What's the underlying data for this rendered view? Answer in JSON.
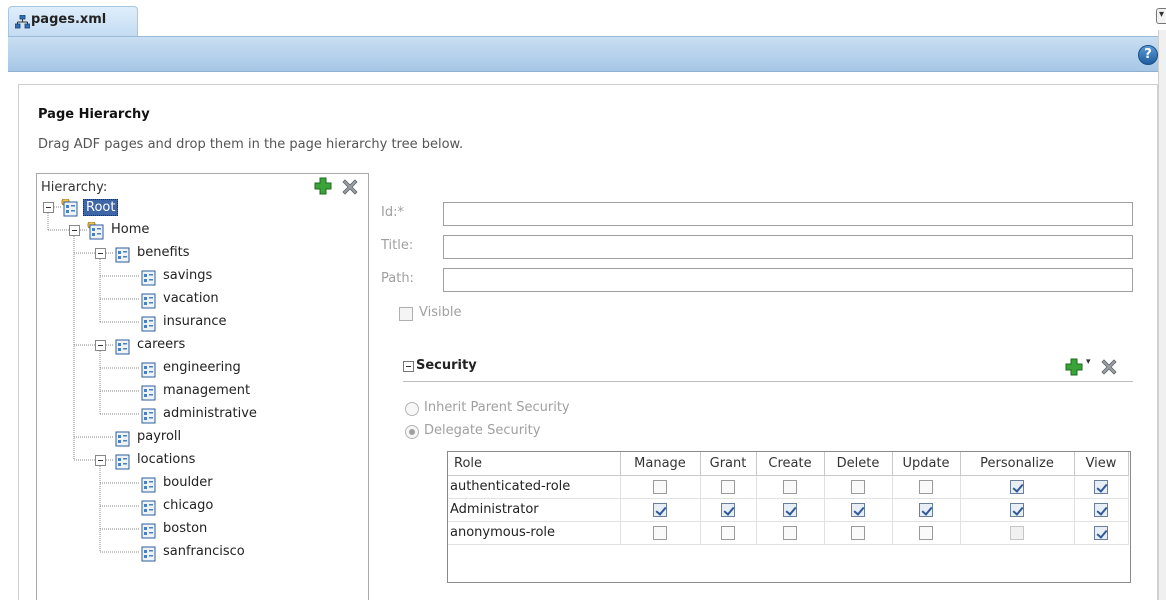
{
  "tab": {
    "label": "pages.xml",
    "icon": "sitemap-icon"
  },
  "help": {
    "label": "?"
  },
  "heading": {
    "title": "Page Hierarchy",
    "description": "Drag ADF pages and drop them in the page hierarchy tree below."
  },
  "hierarchy": {
    "label": "Hierarchy:",
    "nodes": [
      {
        "label": "Root",
        "depth": 0,
        "expandable": true,
        "selected": true,
        "icon": "secure-page-icon"
      },
      {
        "label": "Home",
        "depth": 1,
        "expandable": true,
        "selected": false,
        "icon": "secure-page-icon"
      },
      {
        "label": "benefits",
        "depth": 2,
        "expandable": true,
        "selected": false,
        "icon": "page-icon"
      },
      {
        "label": "savings",
        "depth": 3,
        "expandable": false,
        "selected": false,
        "icon": "page-icon"
      },
      {
        "label": "vacation",
        "depth": 3,
        "expandable": false,
        "selected": false,
        "icon": "page-icon"
      },
      {
        "label": "insurance",
        "depth": 3,
        "expandable": false,
        "selected": false,
        "icon": "page-icon"
      },
      {
        "label": "careers",
        "depth": 2,
        "expandable": true,
        "selected": false,
        "icon": "page-icon"
      },
      {
        "label": "engineering",
        "depth": 3,
        "expandable": false,
        "selected": false,
        "icon": "page-icon"
      },
      {
        "label": "management",
        "depth": 3,
        "expandable": false,
        "selected": false,
        "icon": "page-icon"
      },
      {
        "label": "administrative",
        "depth": 3,
        "expandable": false,
        "selected": false,
        "icon": "page-icon"
      },
      {
        "label": "payroll",
        "depth": 2,
        "expandable": false,
        "selected": false,
        "icon": "page-icon"
      },
      {
        "label": "locations",
        "depth": 2,
        "expandable": true,
        "selected": false,
        "icon": "page-icon"
      },
      {
        "label": "boulder",
        "depth": 3,
        "expandable": false,
        "selected": false,
        "icon": "page-icon"
      },
      {
        "label": "chicago",
        "depth": 3,
        "expandable": false,
        "selected": false,
        "icon": "page-icon"
      },
      {
        "label": "boston",
        "depth": 3,
        "expandable": false,
        "selected": false,
        "icon": "page-icon"
      },
      {
        "label": "sanfrancisco",
        "depth": 3,
        "expandable": false,
        "selected": false,
        "icon": "page-icon"
      }
    ]
  },
  "form": {
    "id_label": "Id:*",
    "id_value": "",
    "title_label": "Title:",
    "title_value": "",
    "path_label": "Path:",
    "path_value": "",
    "visible_label": "Visible",
    "visible_checked": false
  },
  "security": {
    "title": "Security",
    "options": [
      {
        "label": "Inherit Parent Security",
        "selected": false
      },
      {
        "label": "Delegate Security",
        "selected": true
      }
    ],
    "columns": [
      "Role",
      "Manage",
      "Grant",
      "Create",
      "Delete",
      "Update",
      "Personalize",
      "View"
    ],
    "rows": [
      {
        "role": "authenticated-role",
        "perms": [
          false,
          false,
          false,
          false,
          false,
          true,
          true
        ]
      },
      {
        "role": "Administrator",
        "perms": [
          true,
          true,
          true,
          true,
          true,
          true,
          true
        ]
      },
      {
        "role": "anonymous-role",
        "perms": [
          false,
          false,
          false,
          false,
          false,
          false,
          true
        ]
      }
    ],
    "disabled_cells": [
      [
        2,
        5
      ]
    ]
  },
  "colors": {
    "selection": "#3e66a6",
    "header_band": "#b8d3ee",
    "add_green": "#3aa33a"
  }
}
